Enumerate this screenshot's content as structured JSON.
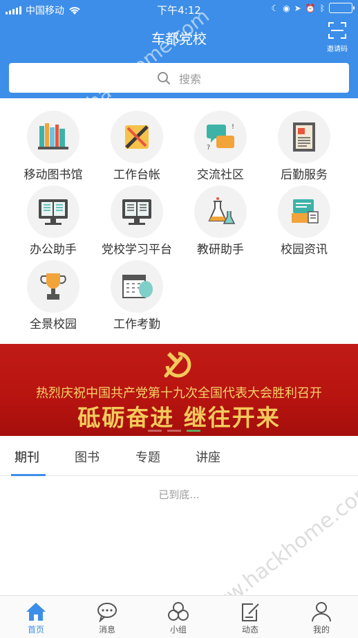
{
  "status_bar": {
    "carrier": "中国移动",
    "time": "下午4:12"
  },
  "header": {
    "title": "车都党校",
    "invite_label": "邀请码"
  },
  "search": {
    "placeholder": "搜索"
  },
  "grid": [
    {
      "label": "移动图书馆",
      "icon": "bookshelf-icon"
    },
    {
      "label": "工作台帐",
      "icon": "ruler-pencil-icon"
    },
    {
      "label": "交流社区",
      "icon": "chat-bubbles-icon"
    },
    {
      "label": "后勤服务",
      "icon": "document-icon"
    },
    {
      "label": "办公助手",
      "icon": "book-monitor-icon"
    },
    {
      "label": "党校学习平台",
      "icon": "open-book-monitor-icon"
    },
    {
      "label": "教研助手",
      "icon": "lab-flask-icon"
    },
    {
      "label": "校园资讯",
      "icon": "laptop-news-icon"
    },
    {
      "label": "全景校园",
      "icon": "trophy-icon"
    },
    {
      "label": "工作考勤",
      "icon": "calendar-icon"
    }
  ],
  "banner": {
    "line1": "热烈庆祝中国共产党第十九次全国代表大会胜利召开",
    "line2": "砥砺奋进  继往开来",
    "slides": 3,
    "active_slide": 3
  },
  "tabs": [
    {
      "label": "期刊",
      "active": true
    },
    {
      "label": "图书",
      "active": false
    },
    {
      "label": "专题",
      "active": false
    },
    {
      "label": "讲座",
      "active": false
    }
  ],
  "list_end_text": "已到底...",
  "bottom_nav": [
    {
      "label": "首页",
      "icon": "home-icon",
      "active": true
    },
    {
      "label": "消息",
      "icon": "message-icon",
      "active": false
    },
    {
      "label": "小组",
      "icon": "group-icon",
      "active": false
    },
    {
      "label": "动态",
      "icon": "edit-icon",
      "active": false
    },
    {
      "label": "我的",
      "icon": "user-icon",
      "active": false
    }
  ],
  "colors": {
    "primary": "#3d8ee8",
    "banner_red": "#b81410",
    "banner_gold": "#f4c95c"
  }
}
